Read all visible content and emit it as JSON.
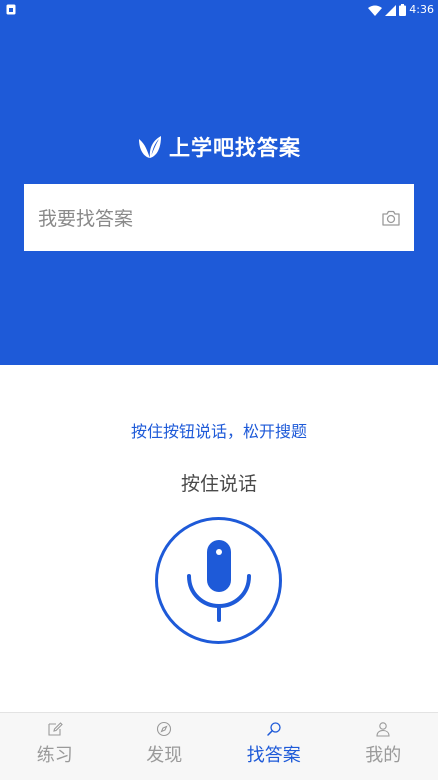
{
  "status_bar": {
    "time": "4:36"
  },
  "brand": {
    "title": "上学吧找答案",
    "accent": "#1e5ad8"
  },
  "search": {
    "placeholder": "我要找答案",
    "camera_icon": "camera-icon"
  },
  "voice": {
    "hint": "按住按钮说话，松开搜题",
    "hold_label": "按住说话",
    "mic_icon": "microphone-icon"
  },
  "tabs": [
    {
      "label": "练习",
      "icon": "edit-icon",
      "active": false
    },
    {
      "label": "发现",
      "icon": "compass-icon",
      "active": false
    },
    {
      "label": "找答案",
      "icon": "search-icon",
      "active": true
    },
    {
      "label": "我的",
      "icon": "user-icon",
      "active": false
    }
  ]
}
